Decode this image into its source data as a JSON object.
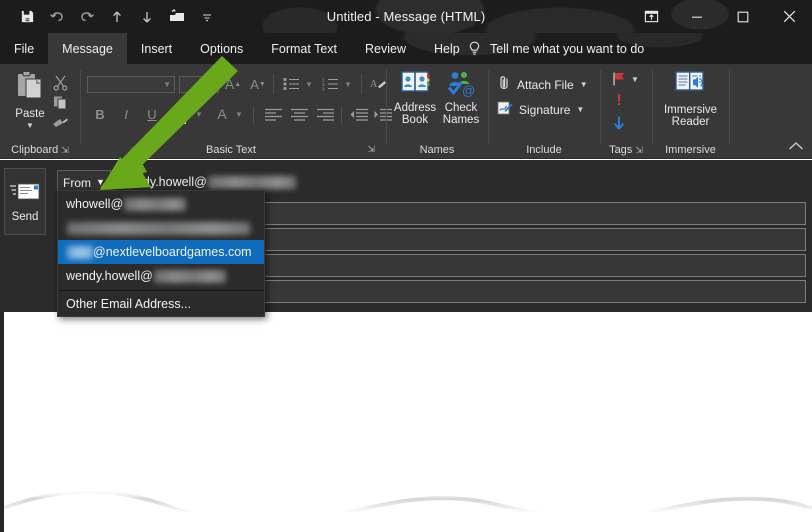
{
  "window": {
    "title": "Untitled  -  Message (HTML)",
    "quick_access": [
      {
        "name": "save-icon",
        "label": "Save"
      },
      {
        "name": "undo-icon",
        "label": "Undo"
      },
      {
        "name": "redo-icon",
        "label": "Redo"
      },
      {
        "name": "previous-item-icon",
        "label": "Previous Item"
      },
      {
        "name": "next-item-icon",
        "label": "Next Item"
      },
      {
        "name": "touch-mode-icon",
        "label": "Touch/Mouse Mode"
      },
      {
        "name": "customize-quick-access-toolbar-icon",
        "label": "Customize Quick Access Toolbar"
      }
    ],
    "controls": [
      {
        "name": "ribbon-display-options-icon",
        "label": "Ribbon Display Options",
        "glyph": "ribbon"
      },
      {
        "name": "minimize-button",
        "label": "Minimize",
        "glyph": "minimize"
      },
      {
        "name": "maximize-button",
        "label": "Maximize",
        "glyph": "maximize"
      },
      {
        "name": "close-button",
        "label": "Close",
        "glyph": "close"
      }
    ]
  },
  "ribbon": {
    "tabs": [
      {
        "label": "File",
        "active": false
      },
      {
        "label": "Message",
        "active": true
      },
      {
        "label": "Insert",
        "active": false
      },
      {
        "label": "Options",
        "active": false
      },
      {
        "label": "Format Text",
        "active": false
      },
      {
        "label": "Review",
        "active": false
      },
      {
        "label": "Help",
        "active": false
      }
    ],
    "tell_me": "Tell me what you want to do",
    "groups": {
      "clipboard": {
        "label": "Clipboard",
        "paste": "Paste",
        "cut": "Cut",
        "copy": "Copy",
        "format_painter": "Format Painter"
      },
      "basic_text": {
        "label": "Basic Text",
        "font_name": "",
        "font_size": "",
        "grow_font": "A",
        "shrink_font": "A",
        "bullets": "Bullets",
        "numbering": "Numbering",
        "clear_formatting": "Clear All Formatting",
        "bold": "B",
        "italic": "I",
        "underline": "U",
        "text_highlight": "Text Highlight Color",
        "font_color": "A",
        "align_left": "Align Left",
        "align_center": "Center",
        "align_right": "Align Right",
        "decrease_indent": "Decrease Indent",
        "increase_indent": "Increase Indent"
      },
      "names": {
        "label": "Names",
        "address_book": "Address\nBook",
        "address_book_line1": "Address",
        "address_book_line2": "Book",
        "check_names_line1": "Check",
        "check_names_line2": "Names"
      },
      "include": {
        "label": "Include",
        "attach_file": "Attach File",
        "signature": "Signature"
      },
      "tags": {
        "label": "Tags",
        "follow_up": "Follow Up",
        "high_importance": "High Importance",
        "low_importance": "Low Importance"
      },
      "immersive": {
        "label": "Immersive",
        "immersive_reader_line1": "Immersive",
        "immersive_reader_line2": "Reader"
      }
    },
    "collapse_label": "Collapse the Ribbon"
  },
  "compose": {
    "send_label": "Send",
    "from_label": "From",
    "from_value_visible": "wendy.howell@",
    "fields": [
      {
        "name": "to-field",
        "value": ""
      },
      {
        "name": "cc-field",
        "value": ""
      },
      {
        "name": "bcc-field",
        "value": ""
      },
      {
        "name": "subject-field",
        "value": ""
      }
    ]
  },
  "from_menu": {
    "items": [
      {
        "label": "whowell@",
        "redacted": true,
        "redact_width": 62,
        "selected": false,
        "leading_redact": 0
      },
      {
        "label": "",
        "redacted": true,
        "redact_width": 183,
        "selected": false,
        "leading_redact": 0
      },
      {
        "label": "@nextlevelboardgames.com",
        "redacted": false,
        "redact_width": 0,
        "selected": true,
        "leading_redact": 22
      },
      {
        "label": "wendy.howell@",
        "redacted": true,
        "redact_width": 72,
        "selected": false,
        "leading_redact": 0
      }
    ],
    "other": "Other Email Address...",
    "highlight_color": "#0f6cbd"
  },
  "annotation": {
    "arrow_color": "#6aa81b",
    "arrow_name": "green-pointer-arrow"
  },
  "colors": {
    "titlebar": "#1c1c1c",
    "ribbon": "#383838",
    "compose": "#2b2b2b",
    "body": "#ffffff",
    "accent_blue": "#0f6cbd",
    "flag_red": "#d13438",
    "low_importance_blue": "#2b7cd3"
  }
}
